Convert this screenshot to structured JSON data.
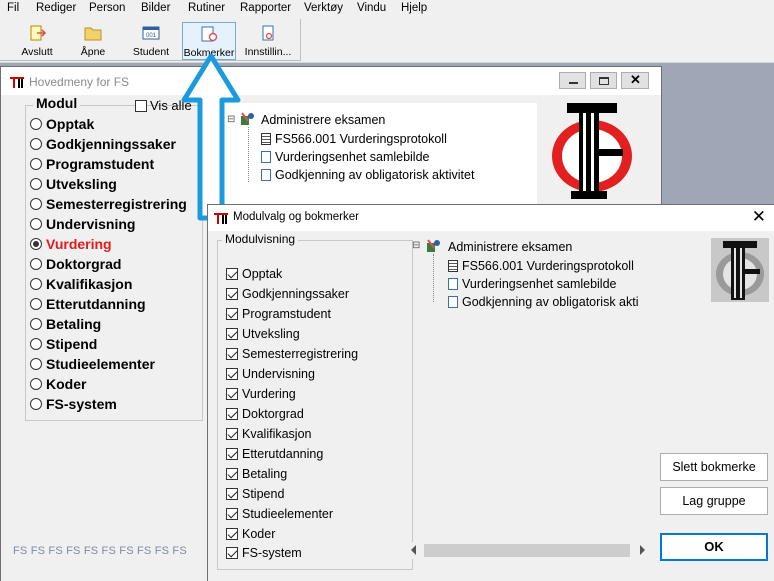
{
  "menubar": {
    "items": [
      "Fil",
      "Rediger",
      "Person",
      "Bilder",
      "Rutiner",
      "Rapporter",
      "Verktøy",
      "Vindu",
      "Hjelp"
    ]
  },
  "toolbar": {
    "buttons": [
      "Avslutt",
      "Åpne",
      "Student",
      "Bokmerker",
      "Innstillin..."
    ]
  },
  "main_window": {
    "title": "Hovedmeny for FS",
    "modul_label": "Modul",
    "vis_alle_label": "Vis alle",
    "modules": [
      "Opptak",
      "Godkjenningssaker",
      "Programstudent",
      "Utveksling",
      "Semesterregistrering",
      "Undervisning",
      "Vurdering",
      "Doktorgrad",
      "Kvalifikasjon",
      "Etterutdanning",
      "Betaling",
      "Stipend",
      "Studieelementer",
      "Koder",
      "FS-system"
    ],
    "selected_module": "Vurdering",
    "tree": {
      "root": "Administrere eksamen",
      "children": [
        "FS566.001 Vurderingsprotokoll",
        "Vurderingsenhet samlebilde",
        "Godkjenning av obligatorisk aktivitet"
      ]
    },
    "fs_strip": "FS FS FS FS FS FS FS FS FS FS"
  },
  "dialog": {
    "title": "Modulvalg og bokmerker",
    "close_glyph": "✕",
    "group_label": "Modulvisning",
    "checkboxes": [
      "Opptak",
      "Godkjenningssaker",
      "Programstudent",
      "Utveksling",
      "Semesterregistrering",
      "Undervisning",
      "Vurdering",
      "Doktorgrad",
      "Kvalifikasjon",
      "Etterutdanning",
      "Betaling",
      "Stipend",
      "Studieelementer",
      "Koder",
      "FS-system"
    ],
    "tree": {
      "root": "Administrere eksamen",
      "children": [
        "FS566.001 Vurderingsprotokoll",
        "Vurderingsenhet samlebilde",
        "Godkjenning av obligatorisk akti"
      ]
    },
    "buttons": {
      "delete_bookmark": "Slett bokmerke",
      "make_group": "Lag gruppe",
      "ok": "OK"
    }
  },
  "colors": {
    "selected_module": "#e41b1b",
    "arrow": "#1a9be0",
    "ok_border": "#0078d7"
  }
}
